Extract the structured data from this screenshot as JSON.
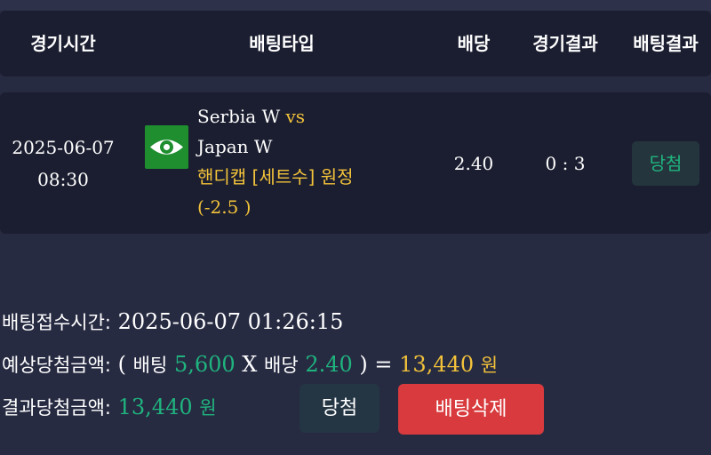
{
  "table_header": {
    "time": "경기시간",
    "bet_type": "배팅타입",
    "odds": "배당",
    "game_result": "경기결과",
    "bet_result": "배팅결과"
  },
  "bet": {
    "date": "2025-06-07",
    "time": "08:30",
    "sport_icon": "eye-icon",
    "home_team": "Serbia W",
    "vs": "vs",
    "away_team": "Japan W",
    "market": "핸디캡 [세트수] 원정",
    "line": "(-2.5 )",
    "odds": "2.40",
    "score": "0 : 3",
    "result": "당첨"
  },
  "summary": {
    "receipt_label": "배팅접수시간:",
    "receipt_time": "2025-06-07 01:26:15",
    "expected_label": "예상당첨금액:",
    "open_paren": "(",
    "bet_word": "배팅",
    "bet_amount": "5,600",
    "multiply": "X",
    "odds_word": "배당",
    "odds": "2.40",
    "close_paren_eq": ") =",
    "expected_amount": "13,440",
    "won": "원",
    "result_label": "결과당첨금액:",
    "result_amount": "13,440",
    "result_won": "원"
  },
  "actions": {
    "win_label": "당첨",
    "delete_label": "배팅삭제"
  },
  "colors": {
    "background": "#272b42",
    "panel": "#1b1e30",
    "accent_yellow": "#f2c23a",
    "win_green": "#1fb47e",
    "delete_red": "#d83a3d",
    "sport_icon_green": "#1e8e2f"
  }
}
